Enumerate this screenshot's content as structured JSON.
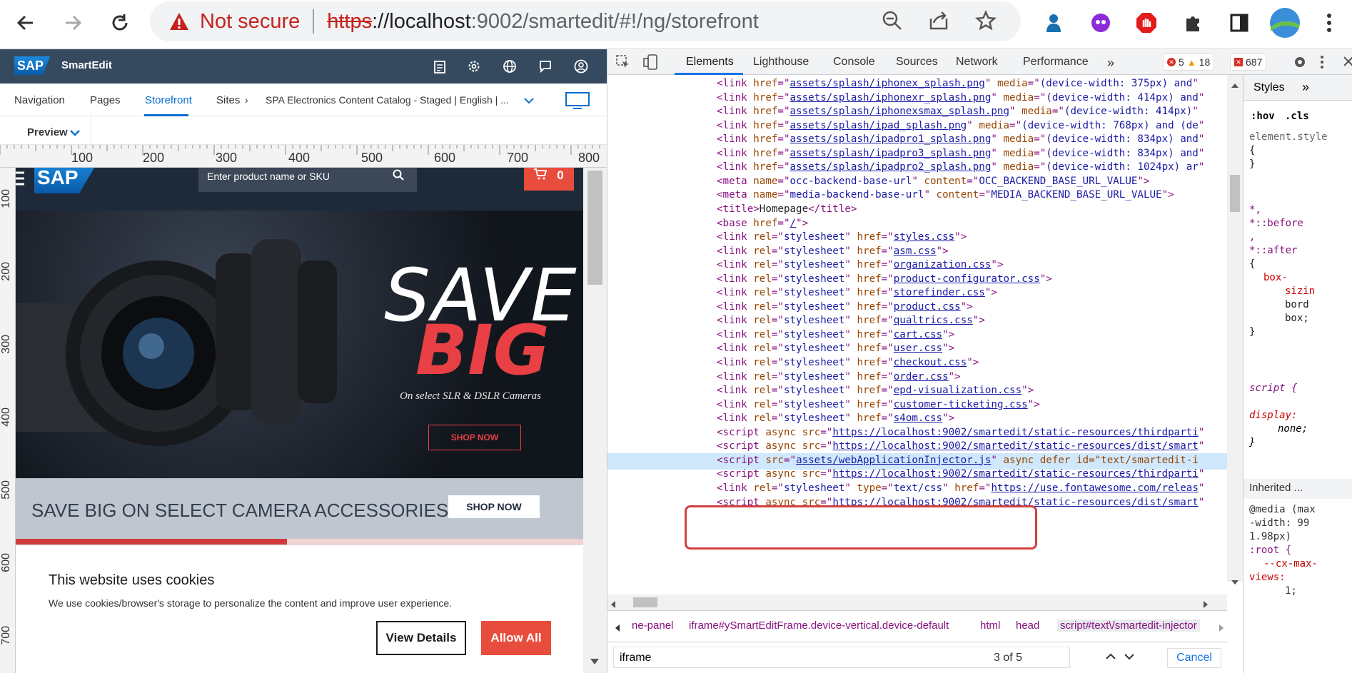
{
  "browser": {
    "not_secure": "Not secure",
    "url_scheme": "https",
    "url_host": "://localhost",
    "url_path": ":9002/smartedit/#!/ng/storefront"
  },
  "smartedit": {
    "logo": "SAP",
    "title": "SmartEdit",
    "nav": {
      "navigation": "Navigation",
      "pages": "Pages",
      "storefront": "Storefront",
      "sites": "Sites",
      "catalog": "SPA Electronics Content Catalog - Staged | English | ..."
    },
    "preview": "Preview"
  },
  "ruler": {
    "top": [
      "100",
      "200",
      "300",
      "400",
      "500",
      "600",
      "700",
      "800"
    ],
    "left": [
      "100",
      "200",
      "300",
      "400",
      "500",
      "600",
      "700"
    ]
  },
  "store": {
    "logo": "SAP",
    "search_placeholder": "Enter product name or SKU",
    "cart_count": "0",
    "hero_save": "SAVE",
    "hero_big": "BIG",
    "hero_sub": "On select SLR & DSLR Cameras",
    "hero_shop": "SHOP NOW",
    "banner_text": "SAVE BIG ON SELECT CAMERA ACCESSORIES",
    "banner_btn": "SHOP NOW"
  },
  "cookie": {
    "title": "This website uses cookies",
    "text": "We use cookies/browser's storage to personalize the content and improve user experience.",
    "view_details": "View Details",
    "allow_all": "Allow All"
  },
  "devtools": {
    "tabs": [
      "Elements",
      "Lighthouse",
      "Console",
      "Sources",
      "Network",
      "Performance"
    ],
    "errors": "5",
    "warnings": "18",
    "issues": "687",
    "lines": [
      {
        "t": "link",
        "href": "assets/splash/iphonex_splash.png",
        "media": "(device-width: 375px) and"
      },
      {
        "t": "link",
        "href": "assets/splash/iphonexr_splash.png",
        "media": "(device-width: 414px) and"
      },
      {
        "t": "link",
        "href": "assets/splash/iphonexsmax_splash.png",
        "media": "(device-width: 414px)"
      },
      {
        "t": "link",
        "href": "assets/splash/ipad_splash.png",
        "media": "(device-width: 768px) and (de"
      },
      {
        "t": "link",
        "href": "assets/splash/ipadpro1_splash.png",
        "media": "(device-width: 834px) and"
      },
      {
        "t": "link",
        "href": "assets/splash/ipadpro3_splash.png",
        "media": "(device-width: 834px) and"
      },
      {
        "t": "link",
        "href": "assets/splash/ipadpro2_splash.png",
        "media": "(device-width: 1024px) ar"
      },
      {
        "t": "meta",
        "name": "occ-backend-base-url",
        "content": "OCC_BACKEND_BASE_URL_VALUE"
      },
      {
        "t": "meta",
        "name": "media-backend-base-url",
        "content": "MEDIA_BACKEND_BASE_URL_VALUE"
      },
      {
        "t": "title",
        "text": "Homepage"
      },
      {
        "t": "base",
        "href": "/"
      },
      {
        "t": "css",
        "href": "styles.css"
      },
      {
        "t": "css",
        "href": "asm.css"
      },
      {
        "t": "css",
        "href": "organization.css"
      },
      {
        "t": "css",
        "href": "product-configurator.css"
      },
      {
        "t": "css",
        "href": "storefinder.css"
      },
      {
        "t": "css",
        "href": "product.css"
      },
      {
        "t": "css",
        "href": "qualtrics.css"
      },
      {
        "t": "css",
        "href": "cart.css"
      },
      {
        "t": "css",
        "href": "user.css"
      },
      {
        "t": "css",
        "href": "checkout.css"
      },
      {
        "t": "css",
        "href": "order.css"
      },
      {
        "t": "css",
        "href": "epd-visualization.css"
      },
      {
        "t": "css",
        "href": "customer-ticketing.css"
      },
      {
        "t": "css",
        "href": "s4om.css"
      },
      {
        "t": "script",
        "src": "https://localhost:9002/smartedit/static-resources/thirdparti"
      },
      {
        "t": "script",
        "src": "https://localhost:9002/smartedit/static-resources/dist/smart"
      },
      {
        "t": "script2",
        "src": "assets/webApplicationInjector.js",
        "tail": " async defer id=\"text/smartedit-i"
      },
      {
        "t": "script",
        "src": "https://localhost:9002/smartedit/static-resources/thirdparti"
      },
      {
        "t": "csslink",
        "href": "https://use.fontawesome.com/releas"
      },
      {
        "t": "script",
        "src": "https://localhost:9002/smartedit/static-resources/dist/smart"
      }
    ],
    "breadcrumbs": [
      "ne-panel",
      "iframe#ySmartEditFrame.device-vertical.device-default",
      "html",
      "head",
      "script#text\\/smartedit-injector"
    ],
    "find_query": "iframe",
    "find_count": "3 of 5",
    "cancel": "Cancel",
    "styles": {
      "tab": "Styles",
      "hov": ":hov",
      "cls": ".cls",
      "element_style": "element.style",
      "inherited": "Inherited ...",
      "media": "@media (max-width: 991.98px)"
    }
  }
}
